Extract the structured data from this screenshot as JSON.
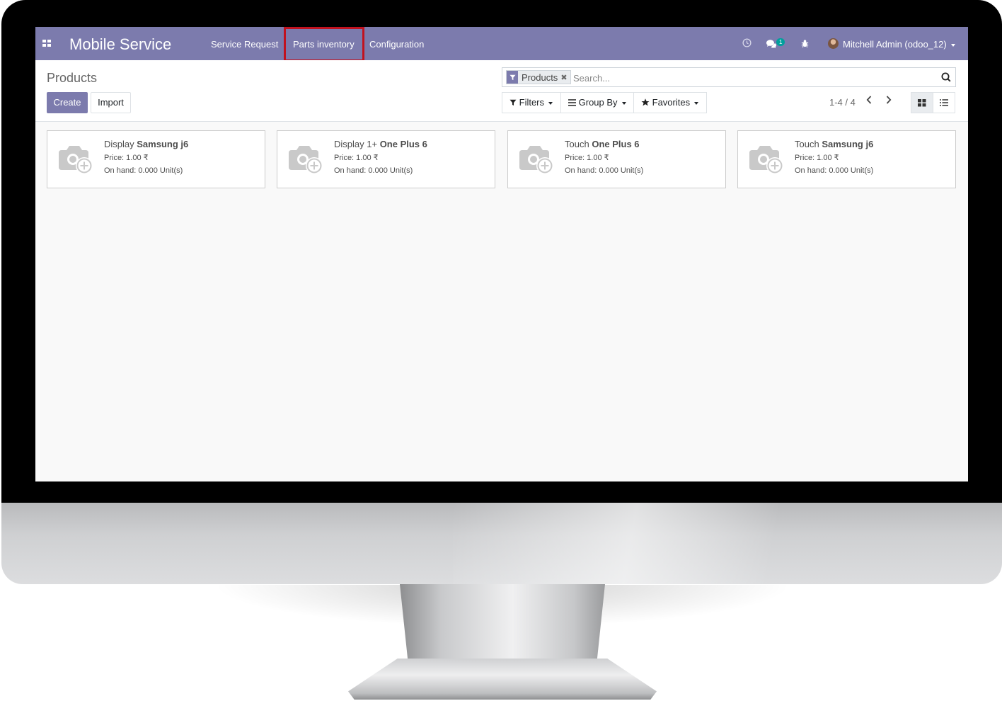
{
  "app": {
    "brand": "Mobile Service",
    "menu": [
      {
        "label": "Service Request"
      },
      {
        "label": "Parts inventory"
      },
      {
        "label": "Configuration"
      }
    ],
    "highlighted_menu": "Parts inventory",
    "messages_badge": "1",
    "user": "Mitchell Admin (odoo_12)",
    "accent_color": "#7c7bad",
    "highlight_color": "#c1121f"
  },
  "control_panel": {
    "title": "Products",
    "create_label": "Create",
    "import_label": "Import",
    "search": {
      "facet_label": "Products",
      "placeholder": "Search..."
    },
    "filters_label": "Filters",
    "groupby_label": "Group By",
    "favorites_label": "Favorites",
    "pager": "1-4 / 4"
  },
  "products": [
    {
      "prefix": "Display",
      "name_bold": "Samsung j6",
      "price": "Price: 1.00 ₹",
      "on_hand": "On hand: 0.000 Unit(s)"
    },
    {
      "prefix": "Display 1+",
      "name_bold": "One Plus 6",
      "price": "Price: 1.00 ₹",
      "on_hand": "On hand: 0.000 Unit(s)"
    },
    {
      "prefix": "Touch",
      "name_bold": "One Plus 6",
      "price": "Price: 1.00 ₹",
      "on_hand": "On hand: 0.000 Unit(s)"
    },
    {
      "prefix": "Touch",
      "name_bold": "Samsung j6",
      "price": "Price: 1.00 ₹",
      "on_hand": "On hand: 0.000 Unit(s)"
    }
  ]
}
